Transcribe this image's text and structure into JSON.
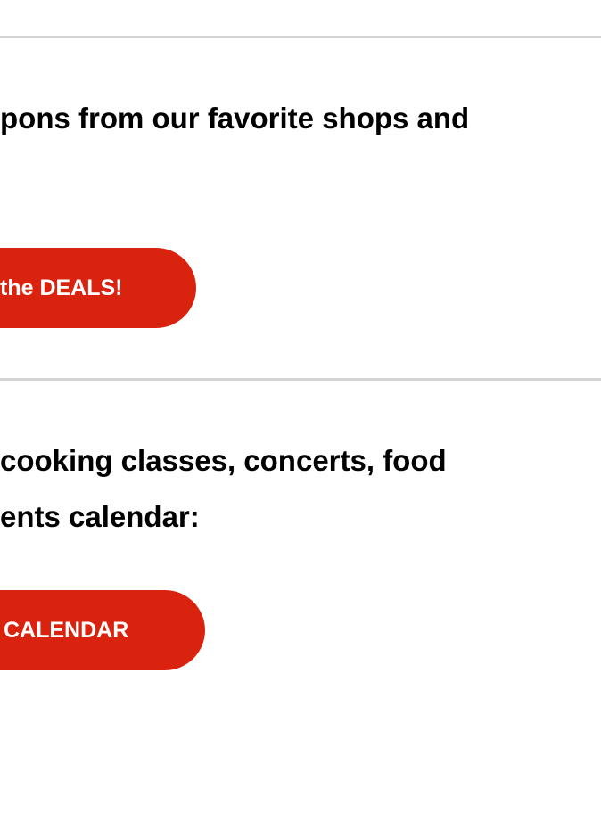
{
  "deals_section": {
    "text_line_1": "pons from our favorite shops and",
    "button_label": "the DEALS!"
  },
  "events_section": {
    "text_line_1": "cooking classes, concerts, food",
    "text_line_2": "ents calendar:",
    "button_label": "CALENDAR"
  },
  "colors": {
    "button_background": "#d9230f",
    "button_text": "#ffffff",
    "divider": "#d4d4d4",
    "body_text": "#000000"
  }
}
